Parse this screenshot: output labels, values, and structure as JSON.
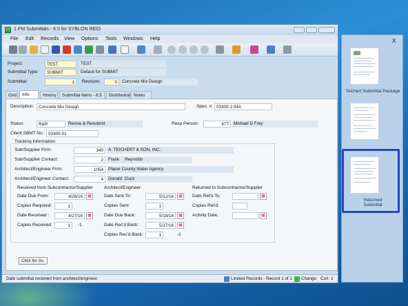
{
  "window": {
    "title": "1 PM Submittals - 6.5 for SYBLON REID"
  },
  "menu": [
    "File",
    "Edit",
    "Records",
    "View",
    "Options",
    "Tools",
    "Windows",
    "Help"
  ],
  "header": {
    "project_label": "Project:",
    "project_code": "TEST.",
    "project_name": "TEST",
    "submittal_type_label": "Submittal Type:",
    "submittal_type_code": "SUBMIT",
    "submittal_type_desc": "Default for SUBMIT",
    "submittal_label": "Submittal:",
    "submittal_number": "1",
    "revision_label": "Revision:",
    "revision_number": "0",
    "submittal_title": "Concrete Mix Design"
  },
  "tabs": [
    "Grid",
    "Info",
    "History",
    "Submittal Items - 6.5",
    "Distribution",
    "Notes"
  ],
  "info": {
    "description_label": "Description:",
    "description_value": "Concrete Mix Design",
    "spec_label": "Spec. #:",
    "spec_value": "03300-2.04A",
    "status_label": "Status:",
    "status_code": "R&R",
    "status_desc": "Revise & Resubmit",
    "resp_label": "Resp Person:",
    "resp_id": "677",
    "resp_name": "Michael D Frey",
    "client_label": "Client SBMT No.:",
    "client_value": "03300-01",
    "tracking_title": "Tracking Information",
    "sub_firm_label": "Sub/Supplier Firm:",
    "sub_firm_id": "340",
    "sub_firm_name": "A. TEICHERT & SON, INC.",
    "sub_contact_label": "Sub/Supplier Contact:",
    "sub_contact_id": "2",
    "sub_contact_first": "Frank",
    "sub_contact_last": "Reynolds",
    "arch_firm_label": "Architect/Engineer Firm:",
    "arch_firm_id": "1054",
    "arch_firm_name": "Placer County Water Agency",
    "arch_contact_label": "Architect/Engineer Contact:",
    "arch_contact_id": "4",
    "arch_contact_first": "Donald",
    "arch_contact_last": "Duck",
    "recv_title": "Received from Subcontractor/Supplier",
    "date_due_from_label": "Date Due From:",
    "date_due_from": "4/28/16",
    "copies_required_label": "Copies Required:",
    "copies_required": "1",
    "date_received_label": "Date Received :",
    "date_received": "4/27/16",
    "copies_received_label": "Copies Received:",
    "copies_received": "1",
    "copies_received_extra": "-1",
    "arch_title": "Architect/Engineer",
    "date_sent_to_label": "Date Sent To:",
    "date_sent_to": "5/12/16",
    "copies_sent_label": "Copies Sent:",
    "copies_sent": "1",
    "date_due_back_label": "Date Due Back:",
    "date_due_back": "5/18/16",
    "date_recd_back_label": "Date Rec'd Back:",
    "date_recd_back": "5/17/16",
    "copies_recd_back_label": "Copies Rec'd Back:",
    "copies_recd_back": "1",
    "copies_recd_back_extra": "-1",
    "ret_title": "Returned to Subcontractor/Supplier",
    "date_retd_to_label": "Date Ret'd To:",
    "date_retd_to": "",
    "copies_retd_label": "Copies Ret'd:",
    "copies_retd": "",
    "activity_date_label": "Activity Date:",
    "activity_date": "",
    "click_button": "Click for Su"
  },
  "status_bar": {
    "message": "Date submittal received from architect/engineer.",
    "records": "Limited Records - Record 1 of 1",
    "change": "Change",
    "co": "Co#: 1"
  },
  "side_pane": {
    "close": "X",
    "items": [
      {
        "label": "Teichert Submittal Package"
      },
      {
        "label": ""
      },
      {
        "label": "Returned Submittal"
      }
    ]
  },
  "colors": {
    "selection_border": "#2a43c9",
    "yellow_field": "#fffbd0",
    "calendar_icon": "#cc3333"
  }
}
